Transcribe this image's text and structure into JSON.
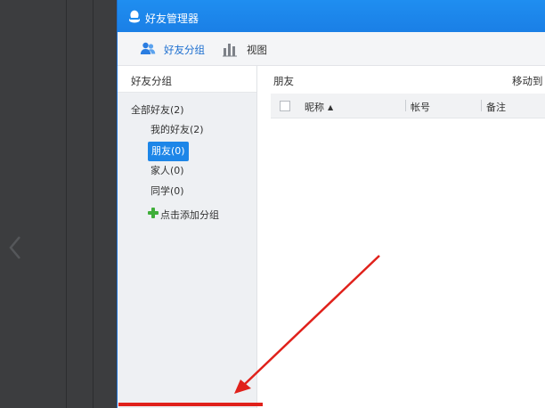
{
  "window": {
    "title": "好友管理器",
    "accent_color": "#1d86e8",
    "titlebar_color": "#1f8ef0"
  },
  "toolbar": {
    "items": [
      {
        "label": "好友分组",
        "icon": "users-icon",
        "active": true
      },
      {
        "label": "视图",
        "icon": "bar-chart-icon",
        "active": false
      }
    ]
  },
  "sidebar": {
    "header": "好友分组",
    "all_friends": "全部好友(2)",
    "groups": [
      {
        "label": "我的好友(2)",
        "selected": false
      },
      {
        "label": "朋友(0)",
        "selected": true
      },
      {
        "label": "家人(0)",
        "selected": false
      },
      {
        "label": "同学(0)",
        "selected": false
      }
    ],
    "add_group": "点击添加分组"
  },
  "main": {
    "current_group": "朋友",
    "move_to": "移动到",
    "columns": {
      "nickname": "昵称",
      "sort_indicator": "▲",
      "account": "帐号",
      "note": "备注"
    }
  },
  "annotation": {
    "color": "#e0211b"
  }
}
